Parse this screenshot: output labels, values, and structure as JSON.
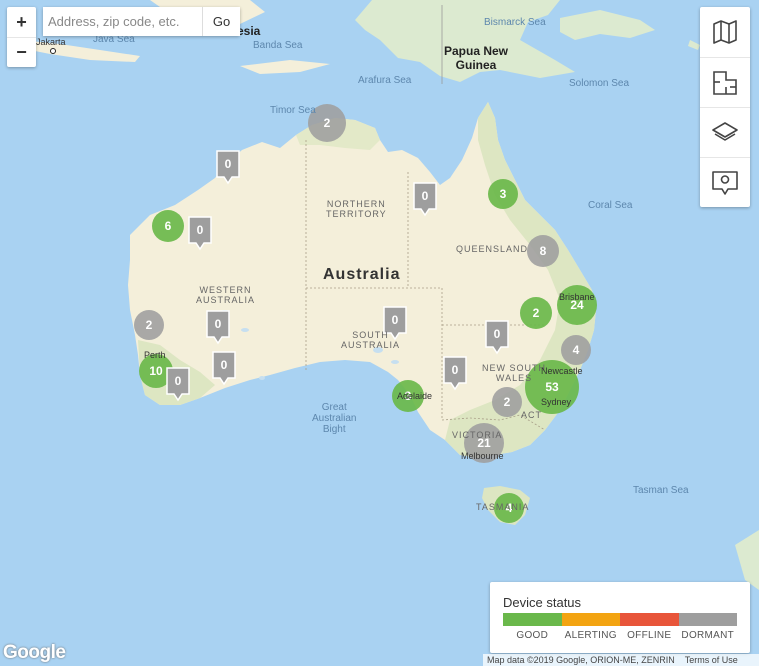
{
  "map": {
    "colors": {
      "water": "#a9d2f2",
      "land": "#f4efda",
      "green": "#d8e6bf",
      "good": "#6ab84b",
      "dormant": "#9e9e9e"
    },
    "labels": {
      "jakarta": "Jakarta",
      "java_sea": "Java Sea",
      "indonesia": "esia",
      "banda_sea": "Banda Sea",
      "bismarck_sea": "Bismarck Sea",
      "png": "Papua New\nGuinea",
      "arafura_sea": "Arafura Sea",
      "solomon_sea": "Solomon Sea",
      "timor_sea": "Timor Sea",
      "coral_sea": "Coral Sea",
      "tasman_sea": "Tasman Sea",
      "great_bight": "Great\nAustralian\nBight",
      "australia": "Australia",
      "nt": "NORTHERN\nTERRITORY",
      "qld": "QUEENSLAND",
      "wa": "WESTERN\nAUSTRALIA",
      "sa": "SOUTH\nAUSTRALIA",
      "nsw": "NEW SOUTH\nWALES",
      "vic": "VICTORIA",
      "act": "ACT",
      "tas": "TASMANIA",
      "perth": "Perth",
      "adelaide": "Adelaide",
      "brisbane": "Brisbane",
      "newcastle": "Newcastle",
      "sydney": "Sydney",
      "melbourne": "Melbourne"
    }
  },
  "controls": {
    "zoom_in": "+",
    "zoom_out": "−",
    "search_placeholder": "Address, zip code, etc.",
    "search_value": "",
    "go_label": "Go",
    "toolbar_icons": [
      "map-icon",
      "floorplan-icon",
      "layers-icon",
      "location-pin-icon"
    ]
  },
  "clusters": [
    {
      "count": "2",
      "status": "dormant",
      "place": "top-end"
    },
    {
      "count": "3",
      "status": "good",
      "place": "cape-york"
    },
    {
      "count": "6",
      "status": "good",
      "place": "pilbara"
    },
    {
      "count": "8",
      "status": "dormant",
      "place": "central-queensland"
    },
    {
      "count": "24",
      "status": "good",
      "place": "brisbane"
    },
    {
      "count": "2",
      "status": "good",
      "place": "toowoomba"
    },
    {
      "count": "2",
      "status": "dormant",
      "place": "geraldton"
    },
    {
      "count": "4",
      "status": "dormant",
      "place": "newcastle"
    },
    {
      "count": "10",
      "status": "good",
      "place": "perth"
    },
    {
      "count": "53",
      "status": "good",
      "place": "sydney"
    },
    {
      "count": "3",
      "status": "good",
      "place": "adelaide"
    },
    {
      "count": "2",
      "status": "dormant",
      "place": "canberra"
    },
    {
      "count": "21",
      "status": "dormant",
      "place": "melbourne"
    },
    {
      "count": "4",
      "status": "good",
      "place": "hobart"
    }
  ],
  "pins": [
    {
      "count": "0",
      "status": "dormant",
      "place": "kimberley"
    },
    {
      "count": "0",
      "status": "dormant",
      "place": "pilbara-inland"
    },
    {
      "count": "0",
      "status": "dormant",
      "place": "gulf-country"
    },
    {
      "count": "0",
      "status": "dormant",
      "place": "goldfields"
    },
    {
      "count": "0",
      "status": "dormant",
      "place": "kalgoorlie"
    },
    {
      "count": "0",
      "status": "dormant",
      "place": "albany"
    },
    {
      "count": "0",
      "status": "dormant",
      "place": "port-augusta"
    },
    {
      "count": "0",
      "status": "dormant",
      "place": "bourke"
    },
    {
      "count": "0",
      "status": "dormant",
      "place": "mildura"
    }
  ],
  "legend": {
    "title": "Device status",
    "items": [
      {
        "label": "GOOD",
        "color": "#6ab84b"
      },
      {
        "label": "ALERTING",
        "color": "#f3a411"
      },
      {
        "label": "OFFLINE",
        "color": "#e8553a"
      },
      {
        "label": "DORMANT",
        "color": "#9e9e9e"
      }
    ]
  },
  "footer": {
    "logo": "Google",
    "map_data": "Map data ©2019 Google, ORION-ME, ZENRIN",
    "terms": "Terms of Use"
  }
}
